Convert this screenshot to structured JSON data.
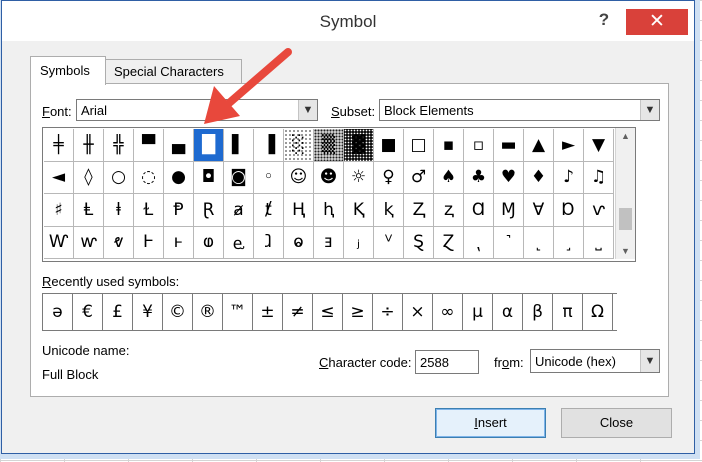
{
  "dialog": {
    "title": "Symbol",
    "help_label": "?",
    "close_label": "✕"
  },
  "tabs": [
    {
      "label": "Symbols",
      "active": true
    },
    {
      "label": "Special Characters",
      "active": false
    }
  ],
  "font": {
    "label_u": "F",
    "label_rest": "ont:",
    "value": "Arial"
  },
  "subset": {
    "label_u": "S",
    "label_rest": "ubset:",
    "value": "Block Elements"
  },
  "symbols": [
    [
      "╪",
      "╫",
      "╬",
      "▀",
      "▄",
      "█",
      "▌",
      "▐",
      "░",
      "▒",
      "▓",
      "■",
      "□",
      "▪",
      "▫",
      "▬",
      "▲",
      "►",
      "▼"
    ],
    [
      "◄",
      "◊",
      "○",
      "◌",
      "●",
      "◘",
      "◙",
      "◦",
      "☺",
      "☻",
      "☼",
      "♀",
      "♂",
      "♠",
      "♣",
      "♥",
      "♦",
      "♪",
      "♫"
    ],
    [
      "♯",
      "Ⱡ",
      "ⱡ",
      "Ɫ",
      "Ᵽ",
      "Ɽ",
      "ⱥ",
      "ⱦ",
      "Ⱨ",
      "ⱨ",
      "Ⱪ",
      "ⱪ",
      "Ⱬ",
      "ⱬ",
      "Ɑ",
      "Ɱ",
      "Ɐ",
      "Ɒ",
      "ⱱ"
    ],
    [
      "Ⱳ",
      "ⱳ",
      "ⱴ",
      "Ⱶ",
      "ⱶ",
      "ⱷ",
      "ⱸ",
      "ⱹ",
      "ⱺ",
      "ⱻ",
      "ⱼ",
      "ⱽ",
      "Ȿ",
      "Ɀ",
      "⹁",
      "˺",
      "˻",
      "˼",
      "˽"
    ]
  ],
  "selected_symbol": {
    "row": 0,
    "col": 5
  },
  "recent": {
    "label_u": "R",
    "label_rest": "ecently used symbols:",
    "symbols": [
      "ə",
      "€",
      "£",
      "¥",
      "©",
      "®",
      "™",
      "±",
      "≠",
      "≤",
      "≥",
      "÷",
      "×",
      "∞",
      "µ",
      "α",
      "β",
      "π",
      "Ω"
    ]
  },
  "unicode_name": {
    "label": "Unicode name:",
    "value": "Full Block"
  },
  "character_code": {
    "label_u": "C",
    "label_rest": "haracter code:",
    "value": "2588"
  },
  "from": {
    "label_pre": "fr",
    "label_u": "o",
    "label_rest": "m:",
    "value": "Unicode (hex)"
  },
  "buttons": {
    "insert_u": "I",
    "insert_rest": "nsert",
    "close": "Close"
  },
  "colors": {
    "selection": "#1e6ad0",
    "close_button": "#d9413a",
    "annotation_arrow": "#e8483c"
  }
}
